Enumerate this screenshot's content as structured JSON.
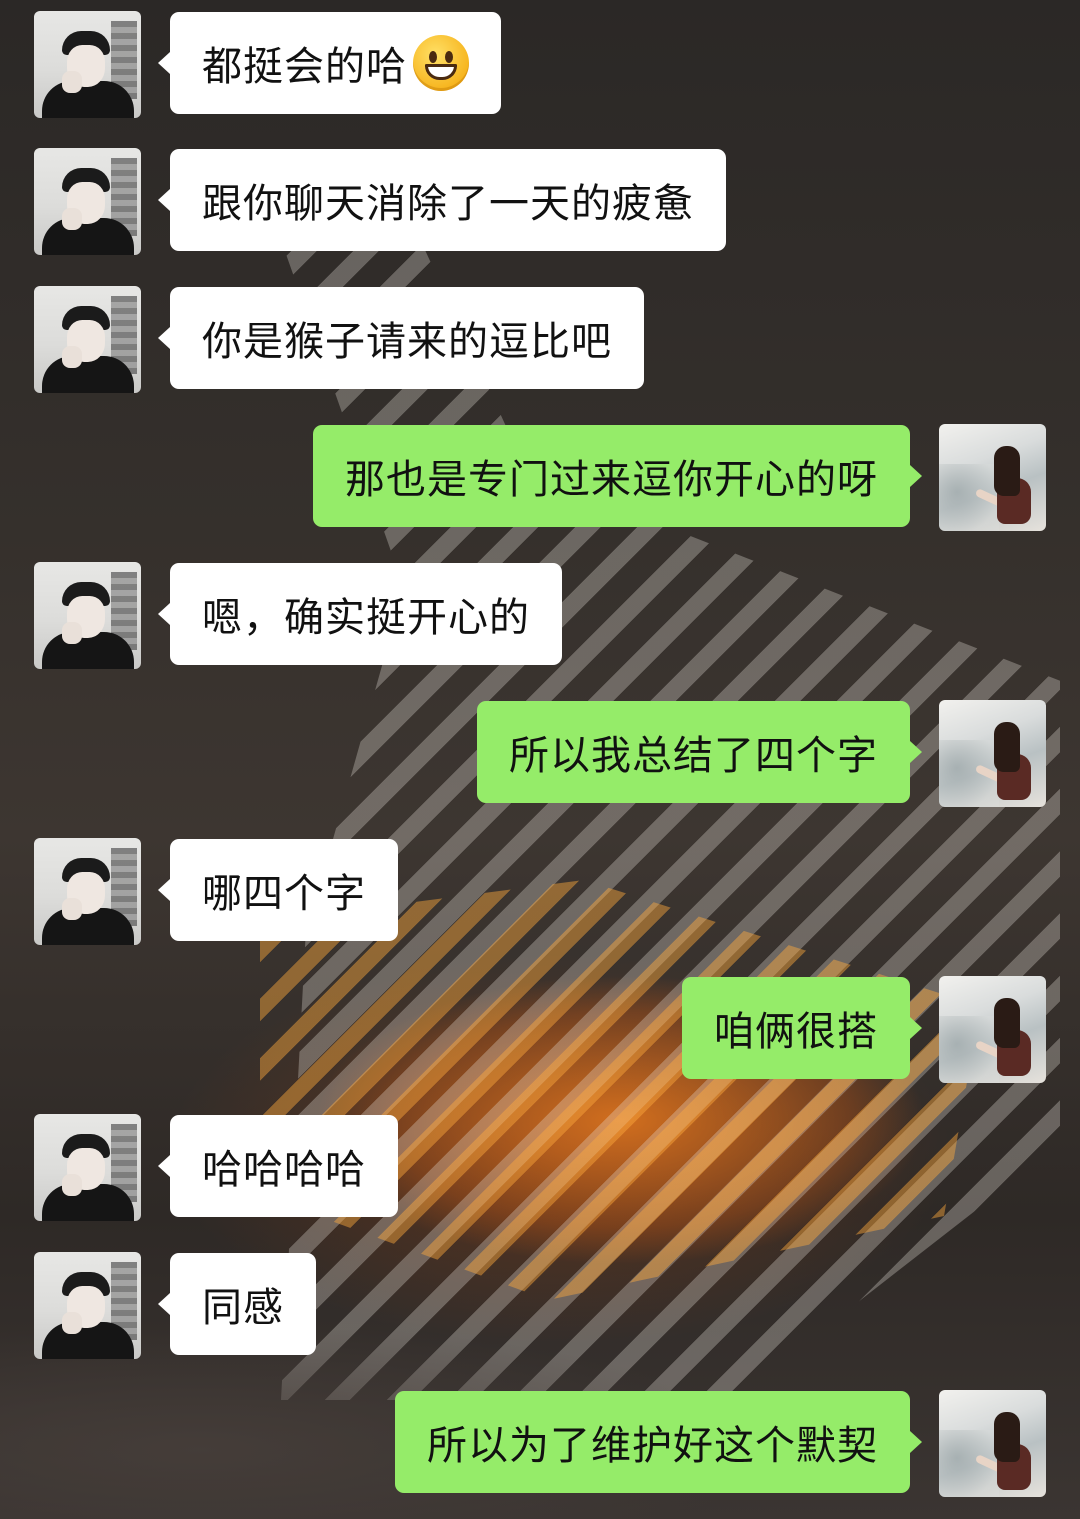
{
  "chat": {
    "messages": [
      {
        "side": "in",
        "text": "都挺会的哈",
        "emoji": "grinning-face-emoji"
      },
      {
        "side": "in",
        "text": "跟你聊天消除了一天的疲惫"
      },
      {
        "side": "in",
        "text": "你是猴子请来的逗比吧"
      },
      {
        "side": "out",
        "text": "那也是专门过来逗你开心的呀"
      },
      {
        "side": "in",
        "text": "嗯，确实挺开心的"
      },
      {
        "side": "out",
        "text": "所以我总结了四个字"
      },
      {
        "side": "in",
        "text": "哪四个字"
      },
      {
        "side": "out",
        "text": "咱俩很搭"
      },
      {
        "side": "in",
        "text": "哈哈哈哈"
      },
      {
        "side": "in",
        "text": "同感"
      },
      {
        "side": "out",
        "text": "所以为了维护好这个默契"
      }
    ]
  },
  "colors": {
    "incoming_bubble": "#ffffff",
    "outgoing_bubble": "#95ec69",
    "text": "#111111"
  },
  "avatars": {
    "incoming": "boy-avatar",
    "outgoing": "girl-avatar"
  }
}
